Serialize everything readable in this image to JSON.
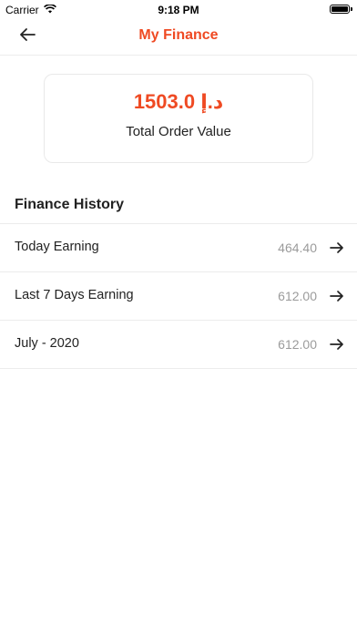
{
  "status_bar": {
    "carrier": "Carrier",
    "time": "9:18 PM",
    "icons": [
      "wifi-icon",
      "battery-icon"
    ]
  },
  "nav": {
    "title": "My Finance",
    "back_icon": "arrow-left-icon"
  },
  "summary": {
    "amount": "د.إ 1503.0",
    "label": "Total Order Value"
  },
  "history": {
    "title": "Finance History",
    "rows": [
      {
        "label": "Today Earning",
        "value": "464.40"
      },
      {
        "label": "Last 7 Days Earning",
        "value": "612.00"
      },
      {
        "label": "July - 2020",
        "value": "612.00"
      }
    ],
    "arrow_icon": "arrow-right-icon"
  },
  "colors": {
    "accent": "#ef4a23",
    "value_gray": "#9b9b9b",
    "divider": "#ececec"
  }
}
